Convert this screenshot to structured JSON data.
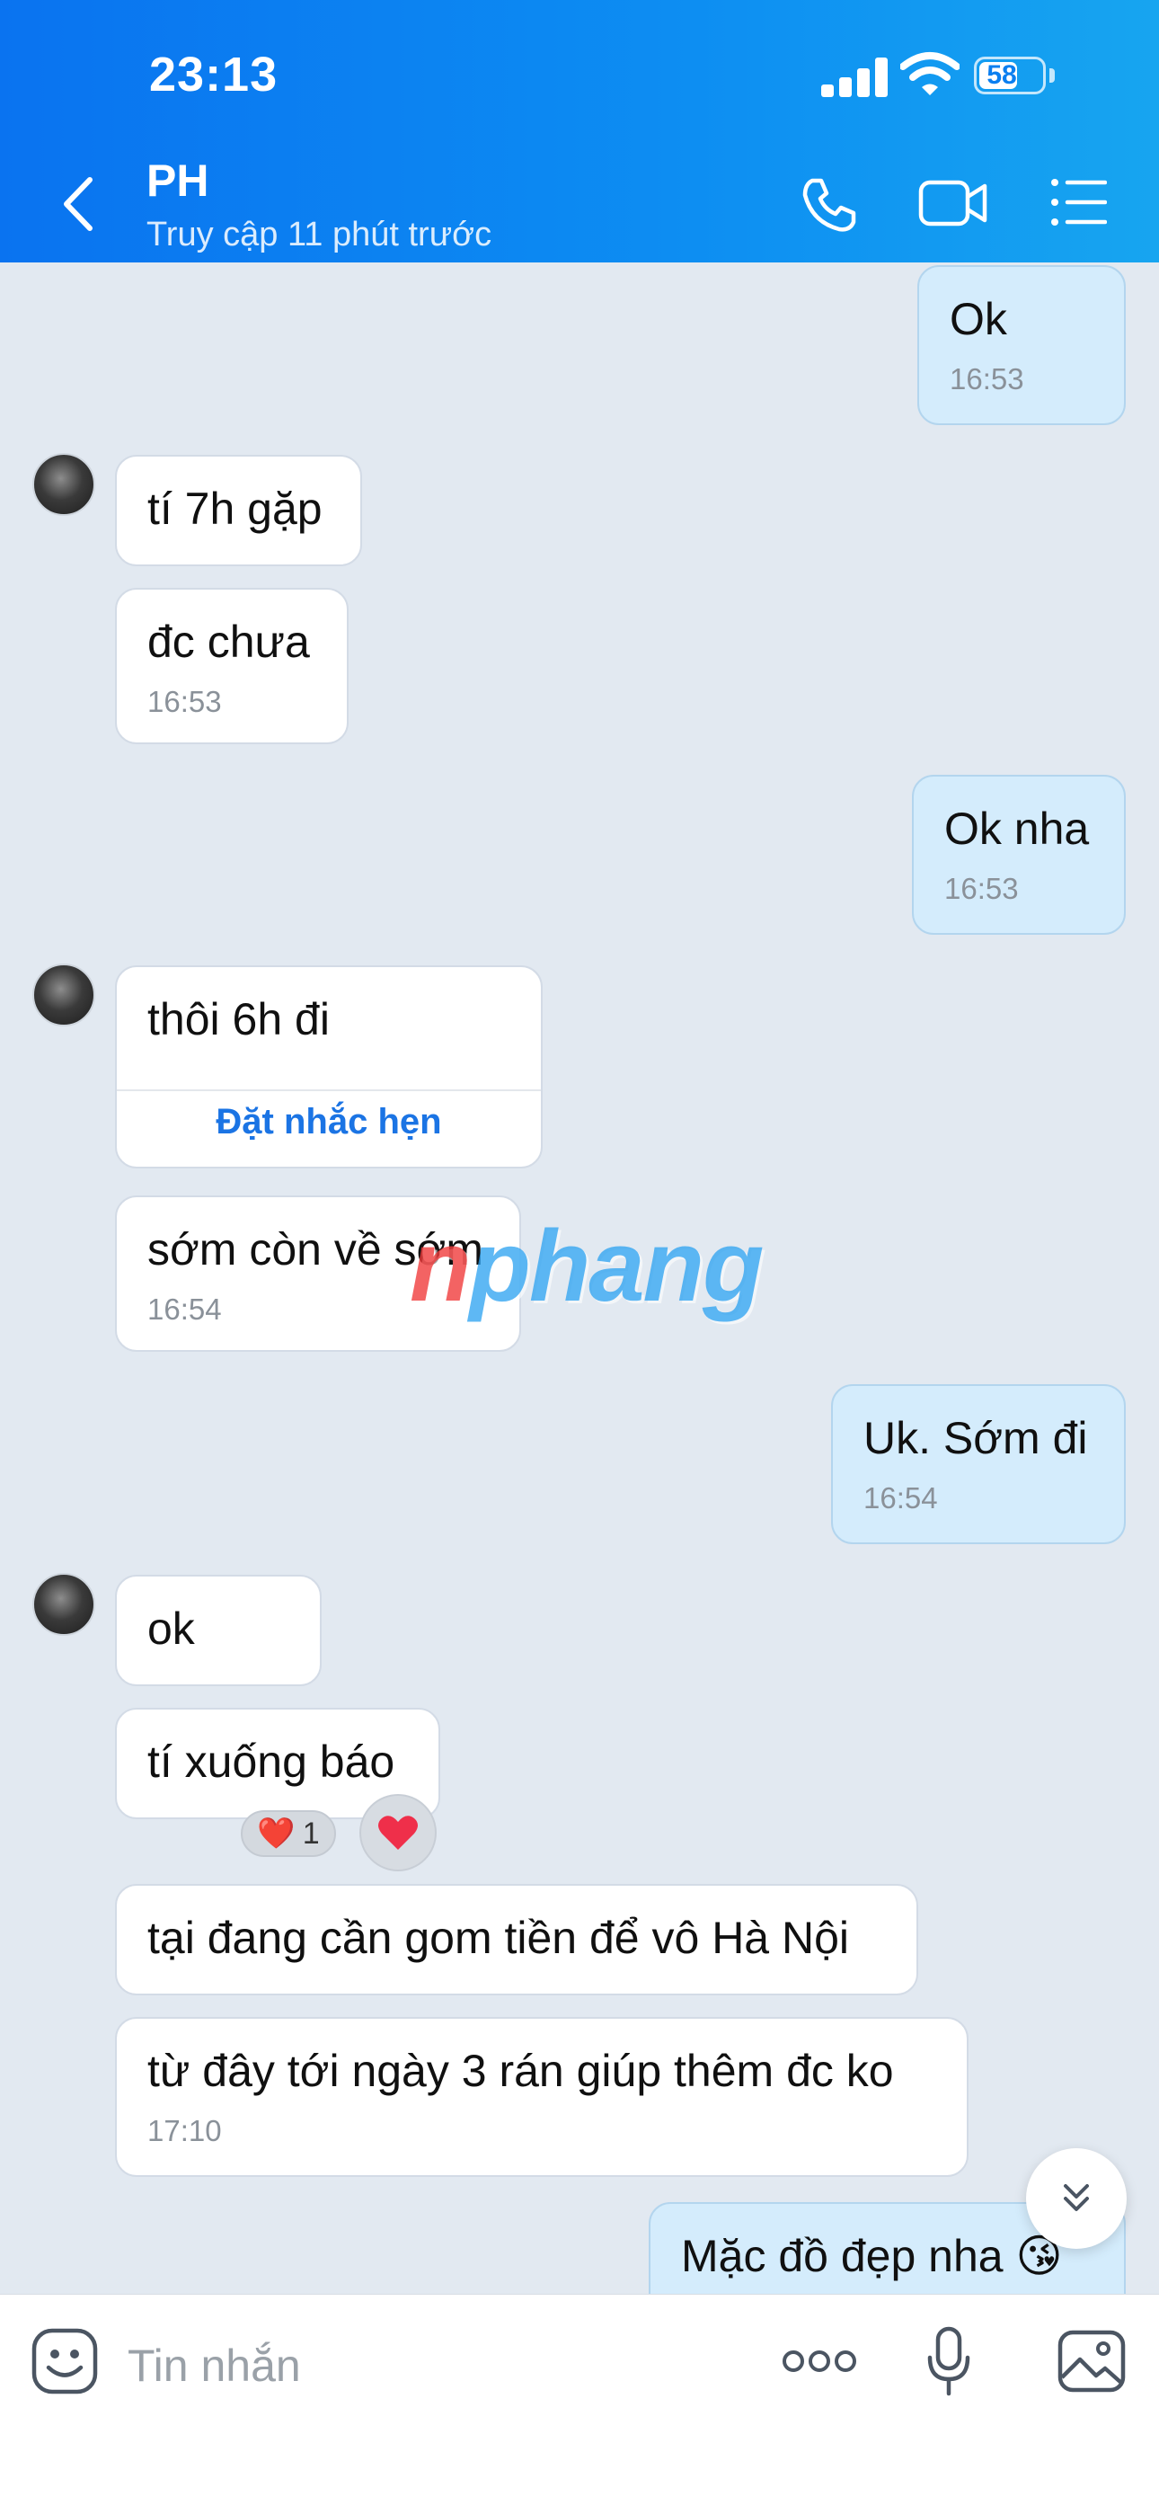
{
  "status_bar": {
    "time": "23:13",
    "battery": "58"
  },
  "header": {
    "contact_name": "PH",
    "contact_status": "Truy cập 11 phút trước",
    "icons": [
      "back-chevron-icon",
      "phone-icon",
      "video-call-icon",
      "menu-list-icon"
    ]
  },
  "messages": [
    {
      "from": "me",
      "text": "Ok",
      "time": "16:53"
    },
    {
      "from": "them",
      "text": "tí 7h gặp"
    },
    {
      "from": "them",
      "text": "đc chưa",
      "time": "16:53"
    },
    {
      "from": "me",
      "text": "Ok nha",
      "time": "16:53"
    },
    {
      "from": "them",
      "text": "thôi 6h đi",
      "action": "Đặt nhắc hẹn"
    },
    {
      "from": "them",
      "text": "sớm còn về sớm",
      "time": "16:54"
    },
    {
      "from": "me",
      "text": "Uk. Sớm đi",
      "time": "16:54"
    },
    {
      "from": "them",
      "text": "ok"
    },
    {
      "from": "them",
      "text": "tí xuống báo",
      "reaction": {
        "emoji": "❤️",
        "count": "1"
      }
    },
    {
      "from": "them",
      "text": "tại đang cần gom tiền để vô Hà Nội"
    },
    {
      "from": "them",
      "text": "từ đây tới ngày 3 rán giúp thêm đc ko",
      "time": "17:10"
    },
    {
      "from": "me",
      "text": "Mặc đồ đẹp nha 😘"
    }
  ],
  "watermark": {
    "first": "n",
    "rest": "phang"
  },
  "composer": {
    "placeholder": "Tin nhắn",
    "icons": [
      "sticker-emoji-icon",
      "more-dots-icon",
      "microphone-icon",
      "image-gallery-icon"
    ]
  },
  "colors": {
    "header_start": "#0a73f0",
    "header_end": "#17a5f0",
    "my_bubble": "#d4ecfc",
    "background": "#e2e9f1",
    "link": "#1b74e4"
  }
}
